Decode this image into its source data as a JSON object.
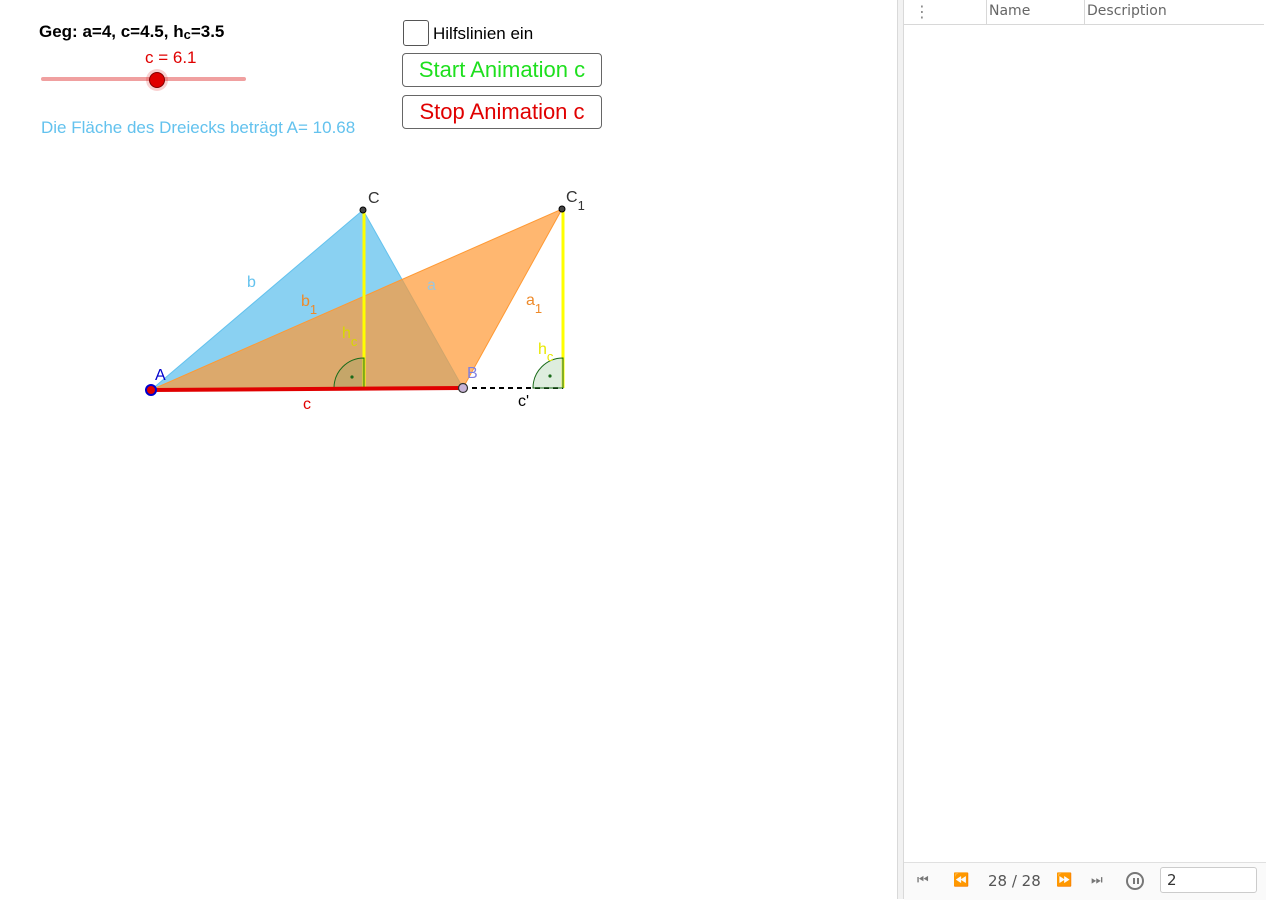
{
  "graphics": {
    "given": {
      "prefix": "Geg: a=4, c=4.5, h",
      "sub": "c",
      "suffix": "=3.5"
    },
    "slider": {
      "label": "c = 6.1",
      "value": 6.1,
      "color": "#e00000"
    },
    "area_text": "Die Fläche des Dreiecks beträgt A= 10.68",
    "checkbox": {
      "label": "Hilfslinien ein",
      "checked": false
    },
    "buttons": {
      "start": "Start Animation c",
      "stop": "Stop Animation c"
    },
    "colors": {
      "triangle_blue": "#63c2ee",
      "triangle_orange": "#ff9933",
      "height_yellow": "#ffff00",
      "segment_red": "#e00000",
      "point_blue": "#0000cc"
    },
    "labels": {
      "A": "A",
      "B": "B",
      "C": "C",
      "C1": "C",
      "C1_sub": "1",
      "b": "b",
      "b1": "b",
      "b1_sub": "1",
      "a": "a",
      "a1": "a",
      "a1_sub": "1",
      "hc": "h",
      "hc_sub": "c",
      "hc2": "h",
      "hc2_sub": "c",
      "c": "c",
      "c_prime": "c'"
    }
  },
  "protocol": {
    "columns": {
      "name": "Name",
      "description": "Description"
    },
    "navigation": {
      "counter": "28 / 28",
      "speed": "2"
    }
  }
}
